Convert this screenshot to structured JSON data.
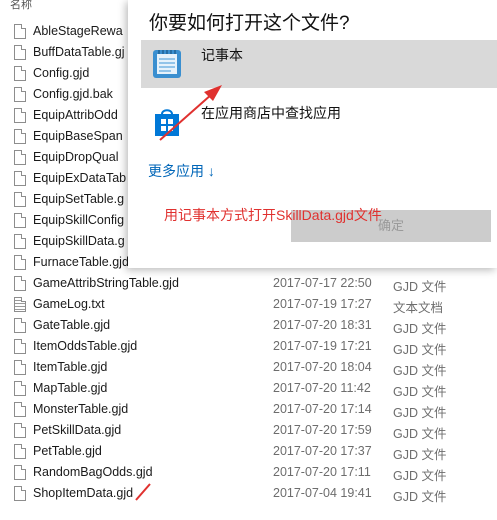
{
  "explorer": {
    "column_header": "名称",
    "files": [
      {
        "name": "AbleStageRewa",
        "date": "",
        "type": "",
        "icon": "file-icon"
      },
      {
        "name": "BuffDataTable.gj",
        "date": "",
        "type": "",
        "icon": "file-icon"
      },
      {
        "name": "Config.gjd",
        "date": "",
        "type": "",
        "icon": "file-icon"
      },
      {
        "name": "Config.gjd.bak",
        "date": "",
        "type": "",
        "icon": "file-icon"
      },
      {
        "name": "EquipAttribOdd",
        "date": "",
        "type": "",
        "icon": "file-icon"
      },
      {
        "name": "EquipBaseSpan",
        "date": "",
        "type": "",
        "icon": "file-icon"
      },
      {
        "name": "EquipDropQual",
        "date": "",
        "type": "",
        "icon": "file-icon"
      },
      {
        "name": "EquipExDataTab",
        "date": "",
        "type": "",
        "icon": "file-icon"
      },
      {
        "name": "EquipSetTable.g",
        "date": "",
        "type": "",
        "icon": "file-icon"
      },
      {
        "name": "EquipSkillConfig",
        "date": "",
        "type": "",
        "icon": "file-icon"
      },
      {
        "name": "EquipSkillData.g",
        "date": "",
        "type": "",
        "icon": "file-icon"
      },
      {
        "name": "FurnaceTable.gjd",
        "date": "",
        "type": "",
        "icon": "file-icon"
      },
      {
        "name": "GameAttribStringTable.gjd",
        "date": "2017-07-17 22:50",
        "type": "GJD 文件",
        "icon": "file-icon"
      },
      {
        "name": "GameLog.txt",
        "date": "2017-07-19 17:27",
        "type": "文本文档",
        "icon": "text-file-icon"
      },
      {
        "name": "GateTable.gjd",
        "date": "2017-07-20 18:31",
        "type": "GJD 文件",
        "icon": "file-icon"
      },
      {
        "name": "ItemOddsTable.gjd",
        "date": "2017-07-19 17:21",
        "type": "GJD 文件",
        "icon": "file-icon"
      },
      {
        "name": "ItemTable.gjd",
        "date": "2017-07-20 18:04",
        "type": "GJD 文件",
        "icon": "file-icon"
      },
      {
        "name": "MapTable.gjd",
        "date": "2017-07-20 11:42",
        "type": "GJD 文件",
        "icon": "file-icon"
      },
      {
        "name": "MonsterTable.gjd",
        "date": "2017-07-20 17:14",
        "type": "GJD 文件",
        "icon": "file-icon"
      },
      {
        "name": "PetSkillData.gjd",
        "date": "2017-07-20 17:59",
        "type": "GJD 文件",
        "icon": "file-icon"
      },
      {
        "name": "PetTable.gjd",
        "date": "2017-07-20 17:37",
        "type": "GJD 文件",
        "icon": "file-icon"
      },
      {
        "name": "RandomBagOdds.gjd",
        "date": "2017-07-20 17:11",
        "type": "GJD 文件",
        "icon": "file-icon"
      },
      {
        "name": "ShopItemData.gjd",
        "date": "2017-07-04 19:41",
        "type": "GJD 文件",
        "icon": "file-icon"
      }
    ]
  },
  "dialog": {
    "title": "你要如何打开这个文件?",
    "options": [
      {
        "label": "记事本",
        "icon": "notepad-icon",
        "selected": true
      },
      {
        "label": "在应用商店中查找应用",
        "icon": "store-icon",
        "selected": false
      }
    ],
    "more_apps": "更多应用 ↓",
    "ok_label": "确定"
  },
  "annotation": {
    "text": "用记事本方式打开SkillData.gjd文件",
    "color": "#e0312f"
  },
  "colors": {
    "selected_row": "#d9d9d9",
    "link": "#0066b8",
    "store_icon": "#0078d7"
  }
}
